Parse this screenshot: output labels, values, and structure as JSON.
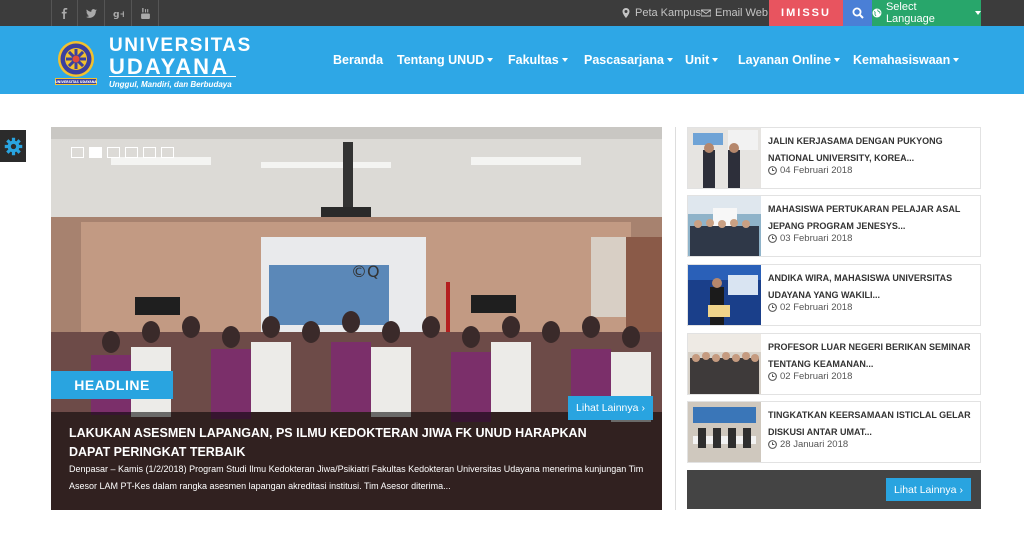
{
  "topbar": {
    "social": [
      "facebook-icon",
      "twitter-icon",
      "google-plus-icon",
      "youtube-icon"
    ],
    "peta_kampus": "Peta Kampus",
    "email_web": "Email Web",
    "imissu": "IMISSU",
    "language": "Select Language"
  },
  "header": {
    "brand_line1": "UNIVERSITAS",
    "brand_line2": "UDAYANA",
    "tagline": "Unggul, Mandiri, dan Berbudaya",
    "logo_text": "UNIVERSITAS UDAYANA",
    "nav": [
      "Beranda",
      "Tentang UNUD",
      "Fakultas",
      "Pascasarjana",
      "Unit",
      "Layanan Online",
      "Kemahasiswaan"
    ]
  },
  "slider": {
    "tag": "HEADLINE",
    "button": "Lihat Lainnya",
    "title": "LAKUKAN ASESMEN LAPANGAN, PS ILMU KEDOKTERAN JIWA FK UNUD HARAPKAN DAPAT PERINGKAT TERBAIK",
    "excerpt": "Denpasar – Kamis (1/2/2018) Program Studi Ilmu Kedokteran Jiwa/Psikiatri Fakultas Kedokteran Universitas Udayana menerima kunjungan Tim Asesor LAM PT-Kes dalam rangka asesmen lapangan akreditasi institusi. Tim Asesor diterima...",
    "screen_text": "©Q"
  },
  "news": [
    {
      "title": "JALIN KERJASAMA DENGAN PUKYONG NATIONAL UNIVERSITY, KOREA...",
      "date": "04 Februari 2018"
    },
    {
      "title": "MAHASISWA PERTUKARAN PELAJAR ASAL JEPANG PROGRAM JENESYS...",
      "date": "03 Februari 2018"
    },
    {
      "title": "ANDIKA WIRA, MAHASISWA UNIVERSITAS UDAYANA YANG WAKILI...",
      "date": "02 Februari 2018"
    },
    {
      "title": "PROFESOR LUAR NEGERI BERIKAN SEMINAR TENTANG KEAMANAN...",
      "date": "02 Februari 2018"
    },
    {
      "title": "TINGKATKAN KEERSAMAAN ISTICLAL GELAR DISKUSI ANTAR UMAT...",
      "date": "28 Januari 2018"
    }
  ],
  "news_more": "Lihat Lainnya",
  "colors": {
    "accent": "#2ea7e6",
    "imissu": "#e8545f",
    "language": "#28a66b",
    "search": "#4a7fd6",
    "topbar": "#3c3c3c"
  }
}
